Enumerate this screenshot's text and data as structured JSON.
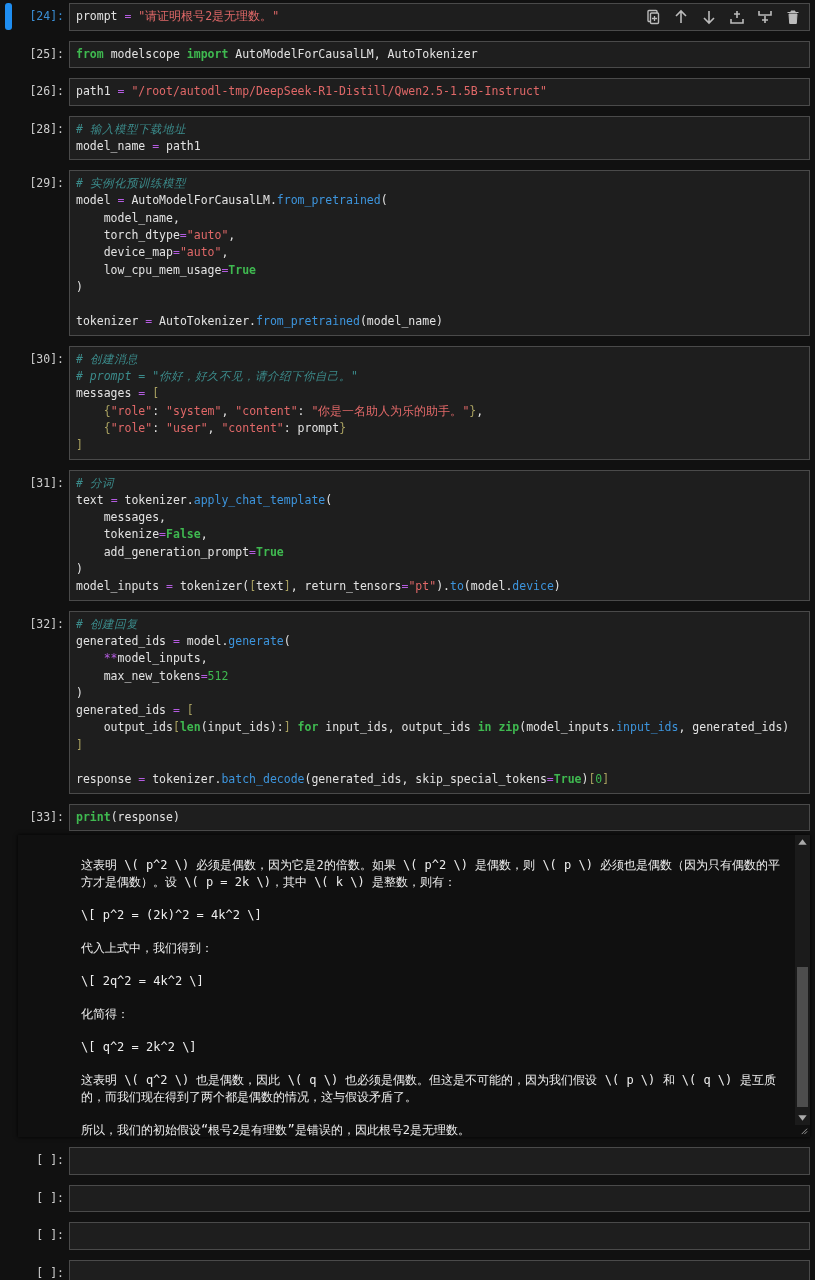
{
  "cells": [
    {
      "prompt": "[24]:",
      "selected": true,
      "lines": [
        {
          "gap_before": false,
          "tokens": [
            {
              "kind": "plain",
              "text": "prompt "
            },
            {
              "kind": "operator",
              "text": "="
            },
            {
              "kind": "string",
              "text": " \"请证明根号2是无理数。\""
            }
          ]
        }
      ]
    },
    {
      "prompt": "[25]:",
      "selected": false,
      "lines": [
        {
          "gap_before": false,
          "tokens": [
            {
              "kind": "keyword",
              "text": "from"
            },
            {
              "kind": "plain",
              "text": " modelscope "
            },
            {
              "kind": "keyword",
              "text": "import"
            },
            {
              "kind": "plain",
              "text": " AutoModelForCausalLM, AutoTokenizer"
            }
          ]
        }
      ]
    },
    {
      "prompt": "[26]:",
      "selected": false,
      "lines": [
        {
          "gap_before": false,
          "tokens": [
            {
              "kind": "plain",
              "text": "path1 "
            },
            {
              "kind": "operator",
              "text": "="
            },
            {
              "kind": "string",
              "text": " \"/root/autodl-tmp/DeepSeek-R1-Distill/Qwen2.5-1.5B-Instruct\""
            }
          ]
        }
      ]
    },
    {
      "prompt": "[28]:",
      "selected": false,
      "lines": [
        {
          "gap_before": false,
          "tokens": [
            {
              "kind": "comment",
              "text": "# 输入模型下载地址"
            }
          ]
        },
        {
          "gap_before": false,
          "tokens": [
            {
              "kind": "plain",
              "text": "model_name "
            },
            {
              "kind": "operator",
              "text": "="
            },
            {
              "kind": "plain",
              "text": " path1"
            }
          ]
        }
      ]
    },
    {
      "prompt": "[29]:",
      "selected": false,
      "lines": [
        {
          "gap_before": false,
          "tokens": [
            {
              "kind": "comment",
              "text": "# 实例化预训练模型"
            }
          ]
        },
        {
          "gap_before": false,
          "tokens": [
            {
              "kind": "plain",
              "text": "model "
            },
            {
              "kind": "operator",
              "text": "="
            },
            {
              "kind": "plain",
              "text": " AutoModelForCausalLM."
            },
            {
              "kind": "call",
              "text": "from_pretrained"
            },
            {
              "kind": "plain",
              "text": "("
            }
          ]
        },
        {
          "gap_before": false,
          "tokens": [
            {
              "kind": "plain",
              "text": "    model_name,"
            }
          ]
        },
        {
          "gap_before": false,
          "tokens": [
            {
              "kind": "plain",
              "text": "    torch_dtype"
            },
            {
              "kind": "operator",
              "text": "="
            },
            {
              "kind": "string",
              "text": "\"auto\""
            },
            {
              "kind": "plain",
              "text": ","
            }
          ]
        },
        {
          "gap_before": false,
          "tokens": [
            {
              "kind": "plain",
              "text": "    device_map"
            },
            {
              "kind": "operator",
              "text": "="
            },
            {
              "kind": "string",
              "text": "\"auto\""
            },
            {
              "kind": "plain",
              "text": ","
            }
          ]
        },
        {
          "gap_before": false,
          "tokens": [
            {
              "kind": "plain",
              "text": "    low_cpu_mem_usage"
            },
            {
              "kind": "operator",
              "text": "="
            },
            {
              "kind": "keyword",
              "text": "True"
            }
          ]
        },
        {
          "gap_before": false,
          "tokens": [
            {
              "kind": "plain",
              "text": ")"
            }
          ]
        },
        {
          "gap_before": true,
          "tokens": [
            {
              "kind": "plain",
              "text": "tokenizer "
            },
            {
              "kind": "operator",
              "text": "="
            },
            {
              "kind": "plain",
              "text": " AutoTokenizer."
            },
            {
              "kind": "call",
              "text": "from_pretrained"
            },
            {
              "kind": "plain",
              "text": "(model_name)"
            }
          ]
        }
      ]
    },
    {
      "prompt": "[30]:",
      "selected": false,
      "lines": [
        {
          "gap_before": false,
          "tokens": [
            {
              "kind": "comment",
              "text": "# 创建消息"
            }
          ]
        },
        {
          "gap_before": false,
          "tokens": [
            {
              "kind": "comment",
              "text": "# prompt = \"你好，好久不见，请介绍下你自己。\""
            }
          ]
        },
        {
          "gap_before": false,
          "tokens": [
            {
              "kind": "plain",
              "text": "messages "
            },
            {
              "kind": "operator",
              "text": "="
            },
            {
              "kind": "bracket",
              "text": " ["
            }
          ]
        },
        {
          "gap_before": false,
          "tokens": [
            {
              "kind": "bracket",
              "text": "    {"
            },
            {
              "kind": "string",
              "text": "\"role\""
            },
            {
              "kind": "plain",
              "text": ": "
            },
            {
              "kind": "string",
              "text": "\"system\""
            },
            {
              "kind": "plain",
              "text": ", "
            },
            {
              "kind": "string",
              "text": "\"content\""
            },
            {
              "kind": "plain",
              "text": ": "
            },
            {
              "kind": "string",
              "text": "\"你是一名助人为乐的助手。\""
            },
            {
              "kind": "bracket",
              "text": "}"
            },
            {
              "kind": "plain",
              "text": ","
            }
          ]
        },
        {
          "gap_before": false,
          "tokens": [
            {
              "kind": "bracket",
              "text": "    {"
            },
            {
              "kind": "string",
              "text": "\"role\""
            },
            {
              "kind": "plain",
              "text": ": "
            },
            {
              "kind": "string",
              "text": "\"user\""
            },
            {
              "kind": "plain",
              "text": ", "
            },
            {
              "kind": "string",
              "text": "\"content\""
            },
            {
              "kind": "plain",
              "text": ": prompt"
            },
            {
              "kind": "bracket",
              "text": "}"
            }
          ]
        },
        {
          "gap_before": false,
          "tokens": [
            {
              "kind": "bracket",
              "text": "]"
            }
          ]
        }
      ]
    },
    {
      "prompt": "[31]:",
      "selected": false,
      "lines": [
        {
          "gap_before": false,
          "tokens": [
            {
              "kind": "comment",
              "text": "# 分词"
            }
          ]
        },
        {
          "gap_before": false,
          "tokens": [
            {
              "kind": "plain",
              "text": "text "
            },
            {
              "kind": "operator",
              "text": "="
            },
            {
              "kind": "plain",
              "text": " tokenizer."
            },
            {
              "kind": "call",
              "text": "apply_chat_template"
            },
            {
              "kind": "plain",
              "text": "("
            }
          ]
        },
        {
          "gap_before": false,
          "tokens": [
            {
              "kind": "plain",
              "text": "    messages,"
            }
          ]
        },
        {
          "gap_before": false,
          "tokens": [
            {
              "kind": "plain",
              "text": "    tokenize"
            },
            {
              "kind": "operator",
              "text": "="
            },
            {
              "kind": "keyword",
              "text": "False"
            },
            {
              "kind": "plain",
              "text": ","
            }
          ]
        },
        {
          "gap_before": false,
          "tokens": [
            {
              "kind": "plain",
              "text": "    add_generation_prompt"
            },
            {
              "kind": "operator",
              "text": "="
            },
            {
              "kind": "keyword",
              "text": "True"
            }
          ]
        },
        {
          "gap_before": false,
          "tokens": [
            {
              "kind": "plain",
              "text": ")"
            }
          ]
        },
        {
          "gap_before": false,
          "tokens": [
            {
              "kind": "plain",
              "text": "model_inputs "
            },
            {
              "kind": "operator",
              "text": "="
            },
            {
              "kind": "plain",
              "text": " tokenizer("
            },
            {
              "kind": "bracket",
              "text": "["
            },
            {
              "kind": "plain",
              "text": "text"
            },
            {
              "kind": "bracket",
              "text": "]"
            },
            {
              "kind": "plain",
              "text": ", return_tensors"
            },
            {
              "kind": "operator",
              "text": "="
            },
            {
              "kind": "string",
              "text": "\"pt\""
            },
            {
              "kind": "plain",
              "text": ")."
            },
            {
              "kind": "call",
              "text": "to"
            },
            {
              "kind": "plain",
              "text": "(model."
            },
            {
              "kind": "call",
              "text": "device"
            },
            {
              "kind": "plain",
              "text": ")"
            }
          ]
        }
      ]
    },
    {
      "prompt": "[32]:",
      "selected": false,
      "lines": [
        {
          "gap_before": false,
          "tokens": [
            {
              "kind": "comment",
              "text": "# 创建回复"
            }
          ]
        },
        {
          "gap_before": false,
          "tokens": [
            {
              "kind": "plain",
              "text": "generated_ids "
            },
            {
              "kind": "operator",
              "text": "="
            },
            {
              "kind": "plain",
              "text": " model."
            },
            {
              "kind": "call",
              "text": "generate"
            },
            {
              "kind": "plain",
              "text": "("
            }
          ]
        },
        {
          "gap_before": false,
          "tokens": [
            {
              "kind": "operator",
              "text": "    **"
            },
            {
              "kind": "plain",
              "text": "model_inputs,"
            }
          ]
        },
        {
          "gap_before": false,
          "tokens": [
            {
              "kind": "plain",
              "text": "    max_new_tokens"
            },
            {
              "kind": "operator",
              "text": "="
            },
            {
              "kind": "number",
              "text": "512"
            }
          ]
        },
        {
          "gap_before": false,
          "tokens": [
            {
              "kind": "plain",
              "text": ")"
            }
          ]
        },
        {
          "gap_before": false,
          "tokens": [
            {
              "kind": "plain",
              "text": "generated_ids "
            },
            {
              "kind": "operator",
              "text": "="
            },
            {
              "kind": "bracket",
              "text": " ["
            }
          ]
        },
        {
          "gap_before": false,
          "tokens": [
            {
              "kind": "plain",
              "text": "    output_ids"
            },
            {
              "kind": "bracket",
              "text": "["
            },
            {
              "kind": "keyword",
              "text": "len"
            },
            {
              "kind": "plain",
              "text": "(input_ids):"
            },
            {
              "kind": "bracket",
              "text": "]"
            },
            {
              "kind": "keyword",
              "text": " for"
            },
            {
              "kind": "plain",
              "text": " input_ids, output_ids "
            },
            {
              "kind": "keyword",
              "text": "in"
            },
            {
              "kind": "keyword",
              "text": " zip"
            },
            {
              "kind": "plain",
              "text": "(model_inputs."
            },
            {
              "kind": "call",
              "text": "input_ids"
            },
            {
              "kind": "plain",
              "text": ", generated_ids)"
            }
          ]
        },
        {
          "gap_before": false,
          "tokens": [
            {
              "kind": "bracket",
              "text": "]"
            }
          ]
        },
        {
          "gap_before": true,
          "tokens": [
            {
              "kind": "plain",
              "text": "response "
            },
            {
              "kind": "operator",
              "text": "="
            },
            {
              "kind": "plain",
              "text": " tokenizer."
            },
            {
              "kind": "call",
              "text": "batch_decode"
            },
            {
              "kind": "plain",
              "text": "(generated_ids, skip_special_tokens"
            },
            {
              "kind": "operator",
              "text": "="
            },
            {
              "kind": "keyword",
              "text": "True"
            },
            {
              "kind": "plain",
              "text": ")"
            },
            {
              "kind": "bracket",
              "text": "["
            },
            {
              "kind": "number",
              "text": "0"
            },
            {
              "kind": "bracket",
              "text": "]"
            }
          ]
        }
      ]
    },
    {
      "prompt": "[33]:",
      "selected": false,
      "lines": [
        {
          "gap_before": false,
          "tokens": [
            {
              "kind": "keyword",
              "text": "print"
            },
            {
              "kind": "plain",
              "text": "(response)"
            }
          ]
        }
      ],
      "output": [
        "这表明 \\( p^2 \\) 必须是偶数，因为它是2的倍数。如果 \\( p^2 \\) 是偶数，则 \\( p \\) 必须也是偶数（因为只有偶数的平方才是偶数）。设 \\( p = 2k \\)，其中 \\( k \\) 是整数，则有：",
        "\\[ p^2 = (2k)^2 = 4k^2 \\]",
        "代入上式中，我们得到：",
        "\\[ 2q^2 = 4k^2 \\]",
        "化简得：",
        "\\[ q^2 = 2k^2 \\]",
        "这表明 \\( q^2 \\) 也是偶数，因此 \\( q \\) 也必须是偶数。但这是不可能的，因为我们假设 \\( p \\) 和 \\( q \\) 是互质的，而我们现在得到了两个都是偶数的情况，这与假设矛盾了。",
        "所以，我们的初始假设“根号2是有理数”是错误的，因此根号2是无理数。"
      ]
    }
  ],
  "empty_cells": [
    {
      "prompt": "[ ]:"
    },
    {
      "prompt": "[ ]:"
    },
    {
      "prompt": "[ ]:"
    },
    {
      "prompt": "[ ]:"
    }
  ]
}
